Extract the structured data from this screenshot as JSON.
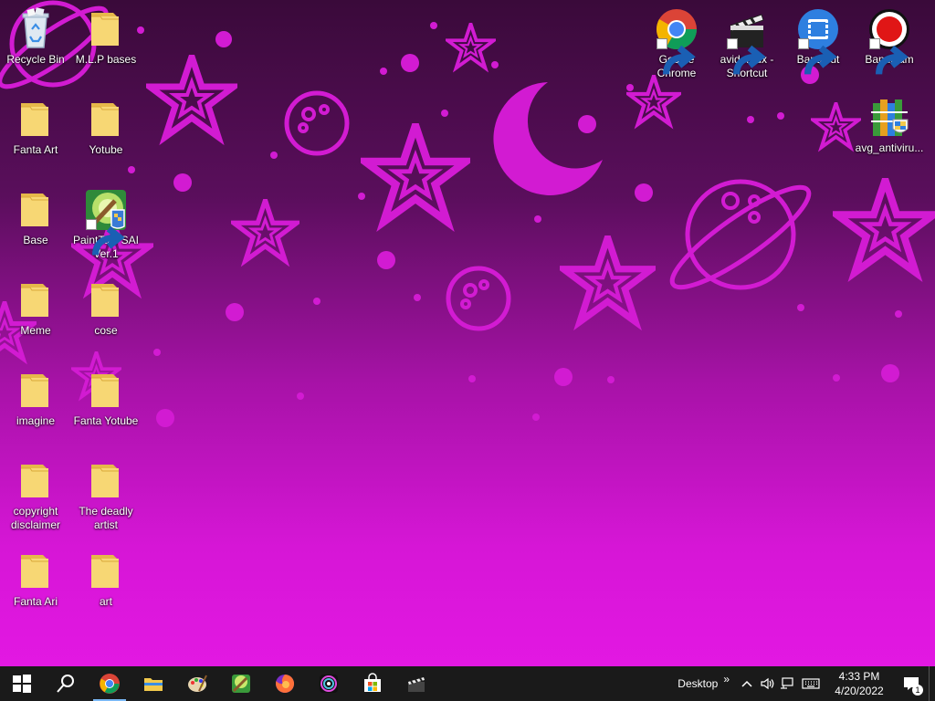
{
  "desktop": {
    "icons_left": [
      {
        "label": "Recycle Bin",
        "type": "recycle"
      },
      {
        "label": "M.L.P bases",
        "type": "folder"
      },
      {
        "label": "Fanta Art",
        "type": "folder"
      },
      {
        "label": "Yotube",
        "type": "folder"
      },
      {
        "label": "Base",
        "type": "folder"
      },
      {
        "label": "PaintTool SAI Ver.1",
        "type": "sai"
      },
      {
        "label": "Meme",
        "type": "folder"
      },
      {
        "label": "cose",
        "type": "folder"
      },
      {
        "label": "imagine",
        "type": "folder"
      },
      {
        "label": "Fanta Yotube",
        "type": "folder"
      },
      {
        "label": "copyright disclaimer",
        "type": "folder"
      },
      {
        "label": "The deadly artist",
        "type": "folder"
      },
      {
        "label": "Fanta Ari",
        "type": "folder"
      },
      {
        "label": "art",
        "type": "folder"
      }
    ],
    "icons_right": [
      {
        "label": "Google Chrome",
        "type": "chrome"
      },
      {
        "label": "avidemux - Shortcut",
        "type": "avidemux"
      },
      {
        "label": "Bandicut",
        "type": "bandicut"
      },
      {
        "label": "Bandicam",
        "type": "bandicam"
      },
      {
        "label": "avg_antiviru...",
        "type": "avg"
      }
    ]
  },
  "taskbar": {
    "pinned": [
      "windows-start-icon",
      "search-icon",
      "chrome-icon",
      "file-explorer-icon",
      "paint-palette-icon",
      "painttool-sai-icon",
      "firefox-icon",
      "media-app-icon",
      "microsoft-store-icon",
      "clapperboard-icon"
    ],
    "tray": {
      "desktop_label": "Desktop",
      "overflow_glyph": "»",
      "time": "4:33 PM",
      "date": "4/20/2022",
      "notification_count": "1"
    }
  },
  "colors": {
    "star": "#d21bd2",
    "taskbar": "#1a1a1a",
    "folder": "#f2c94c"
  }
}
